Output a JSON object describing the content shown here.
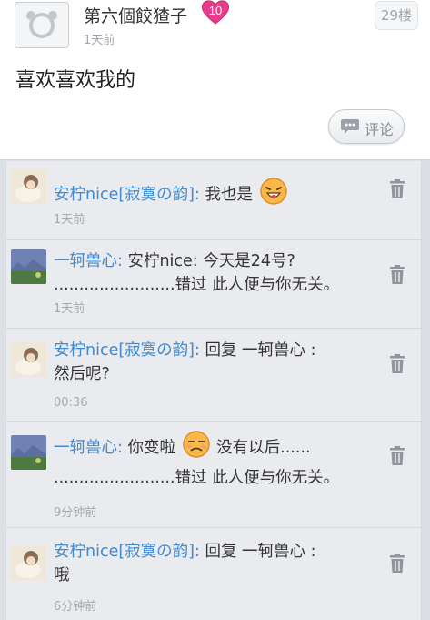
{
  "post": {
    "author": "第六個餃猹子",
    "level": "10",
    "time": "1天前",
    "floor": "29楼",
    "content": "喜欢喜欢我的",
    "comment_label": "评论"
  },
  "replies": [
    {
      "name": "安柠nice[寂寞の韵]:",
      "text_a": " 我也是",
      "text_b": "",
      "time": "1天前",
      "emoji": "grinning-emoji"
    },
    {
      "name": "一轲兽心:",
      "text_a": " 安柠nice: 今天是24号?",
      "text_b": "........................错过 此人便与你无关。",
      "time": "1天前",
      "emoji": ""
    },
    {
      "name": "安柠nice[寂寞の韵]:",
      "text_a": " 回复 一轲兽心 :",
      "text_b": "然后呢?",
      "time": "00:36",
      "emoji": ""
    },
    {
      "name": "一轲兽心:",
      "text_a": " 你变啦",
      "text_a2": " 没有以后......",
      "text_b": "........................错过 此人便与你无关。",
      "time": "9分钟前",
      "emoji": "frowning-emoji"
    },
    {
      "name": "安柠nice[寂寞の韵]:",
      "text_a": " 回复 一轲兽心 :",
      "text_b": "哦",
      "time": "6分钟前",
      "emoji": ""
    }
  ],
  "colors": {
    "name_link": "#3f8ad1",
    "level_badge": "#e93b8a",
    "reply_bg": "#e9ebee"
  }
}
